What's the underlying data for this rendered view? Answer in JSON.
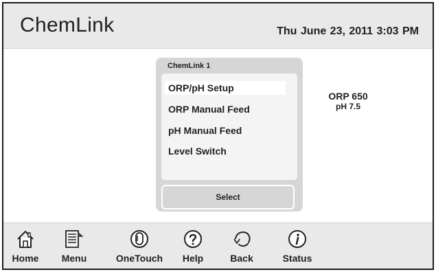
{
  "header": {
    "app_title": "ChemLink",
    "datetime": "Thu June 23, 2011  3:03 PM"
  },
  "dialog": {
    "title": "ChemLink 1",
    "items": [
      {
        "label": "ORP/pH Setup",
        "selected": true
      },
      {
        "label": "ORP Manual Feed",
        "selected": false
      },
      {
        "label": "pH Manual Feed",
        "selected": false
      },
      {
        "label": "Level Switch",
        "selected": false
      }
    ],
    "select_label": "Select"
  },
  "readout": {
    "orp": "ORP 650",
    "ph": "pH 7.5"
  },
  "nav": [
    {
      "label": "Home",
      "icon": "home-icon"
    },
    {
      "label": "Menu",
      "icon": "menu-icon"
    },
    {
      "label": "OneTouch",
      "icon": "onetouch-icon"
    },
    {
      "label": "Help",
      "icon": "help-icon"
    },
    {
      "label": "Back",
      "icon": "back-icon"
    },
    {
      "label": "Status",
      "icon": "status-icon"
    }
  ]
}
